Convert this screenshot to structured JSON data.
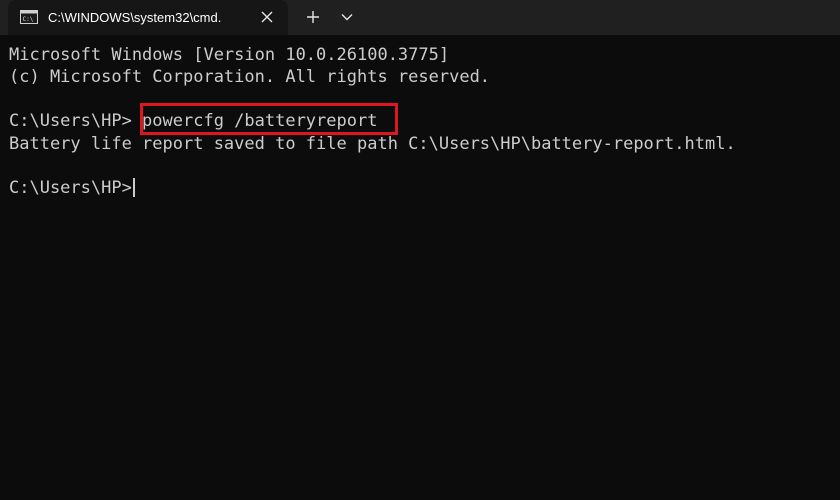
{
  "tab": {
    "title": "C:\\WINDOWS\\system32\\cmd.",
    "icon": "cmd-icon"
  },
  "tabbar": {
    "close_icon": "close-icon",
    "new_tab_icon": "plus-icon",
    "dropdown_icon": "chevron-down-icon"
  },
  "terminal": {
    "lines": [
      "Microsoft Windows [Version 10.0.26100.3775]",
      "(c) Microsoft Corporation. All rights reserved.",
      "",
      "C:\\Users\\HP> powercfg /batteryreport",
      "Battery life report saved to file path C:\\Users\\HP\\battery-report.html.",
      "",
      "C:\\Users\\HP>"
    ],
    "highlighted_command": "powercfg /batteryreport"
  },
  "colors": {
    "background": "#0c0c0c",
    "text": "#cccccc",
    "tabbar": "#202020",
    "active_tab": "#161616",
    "highlight": "#e0161e"
  }
}
